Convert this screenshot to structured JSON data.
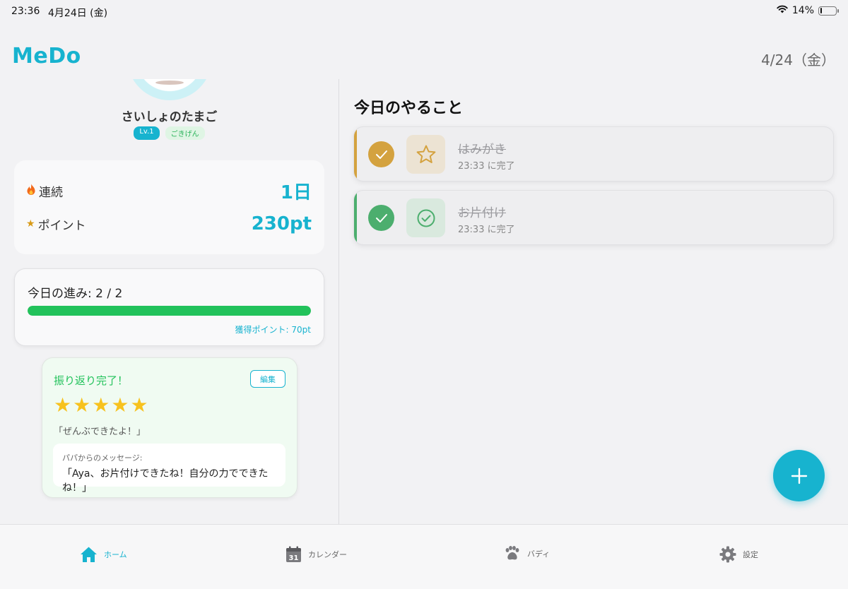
{
  "status_bar": {
    "time": "23:36",
    "date": "4月24日 (金)",
    "battery": "14%",
    "battery_level": 0.14
  },
  "header": {
    "app_title": "MeDo",
    "date": "4/24（金）"
  },
  "buddy": {
    "name": "さいしょのたまご",
    "level": "Lv.1",
    "mood": "ごきげん"
  },
  "stats": {
    "streak_label": "連続",
    "streak_value": "1日",
    "points_label": "ポイント",
    "points_value": "230pt"
  },
  "progress": {
    "title": "今日の進み: 2 / 2",
    "fraction": 1.0,
    "earned": "獲得ポイント: 70pt"
  },
  "review": {
    "title": "振り返り完了！",
    "edit_label": "編集",
    "rating": 5,
    "quote": "「ぜんぶできたよ！」",
    "message_label": "パパからのメッセージ:",
    "message_text": "「Aya、お片付けできたね！自分の力でできたね！」"
  },
  "tasks": {
    "section_title": "今日のやること",
    "items": [
      {
        "name": "はみがき",
        "status": "23:33 に完了",
        "icon": "star-icon",
        "color": "#d4a23f",
        "icon_bg": "#ece3d3"
      },
      {
        "name": "お片付け",
        "status": "23:33 に完了",
        "icon": "check-circle-icon",
        "color": "#4cae6e",
        "icon_bg": "#d9e9de"
      }
    ]
  },
  "tabs": [
    {
      "label": "ホーム",
      "icon": "home-icon",
      "active": true
    },
    {
      "label": "カレンダー",
      "icon": "calendar-icon",
      "active": false,
      "icon_text": "31"
    },
    {
      "label": "バディ",
      "icon": "paw-icon",
      "active": false
    },
    {
      "label": "設定",
      "icon": "gear-icon",
      "active": false
    }
  ],
  "colors": {
    "accent": "#17b3cf",
    "success": "#22c25b",
    "star": "#f7c21e"
  }
}
